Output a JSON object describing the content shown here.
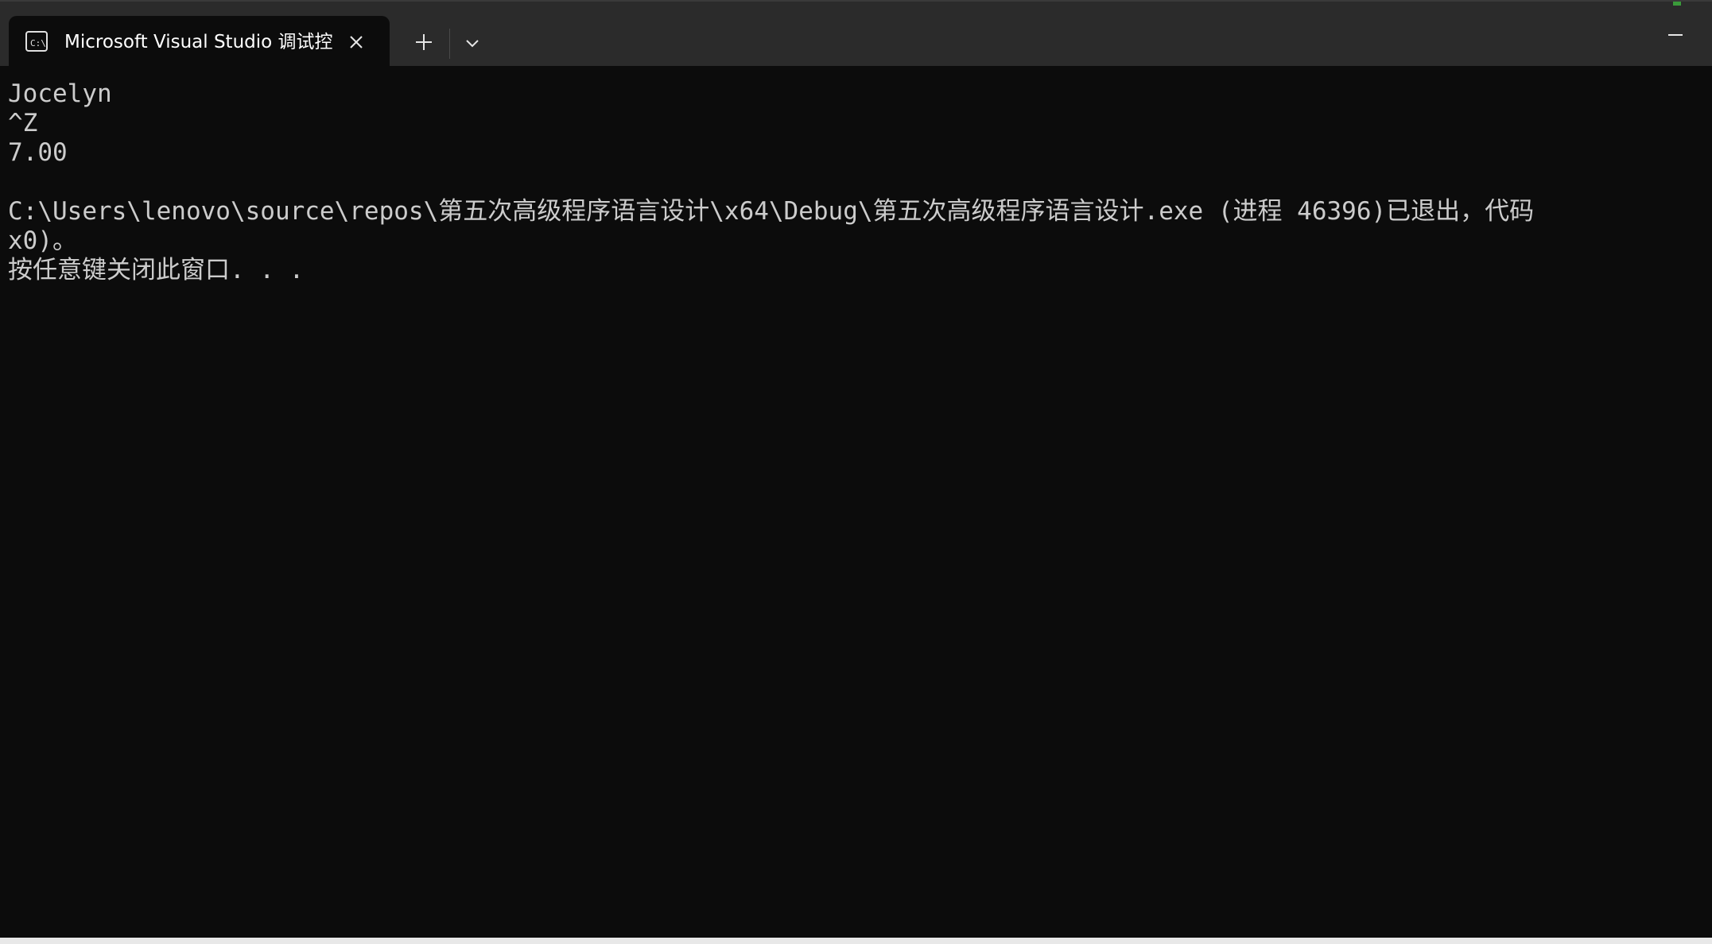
{
  "tab": {
    "title": "Microsoft Visual Studio 调试控",
    "icon": "console-icon"
  },
  "titlebar": {
    "new_tab_icon": "plus-icon",
    "dropdown_icon": "chevron-down-icon",
    "minimize_icon": "minimize-icon",
    "close_icon": "close-icon"
  },
  "console": {
    "lines": [
      "Jocelyn",
      "^Z",
      "7.00",
      "",
      "C:\\Users\\lenovo\\source\\repos\\第五次高级程序语言设计\\x64\\Debug\\第五次高级程序语言设计.exe (进程 46396)已退出，代码",
      "x0)。",
      "按任意键关闭此窗口. . ."
    ]
  },
  "colors": {
    "background": "#0c0c0c",
    "titlebar": "#2b2b2b",
    "text": "#cccccc",
    "tab_text": "#ffffff"
  }
}
